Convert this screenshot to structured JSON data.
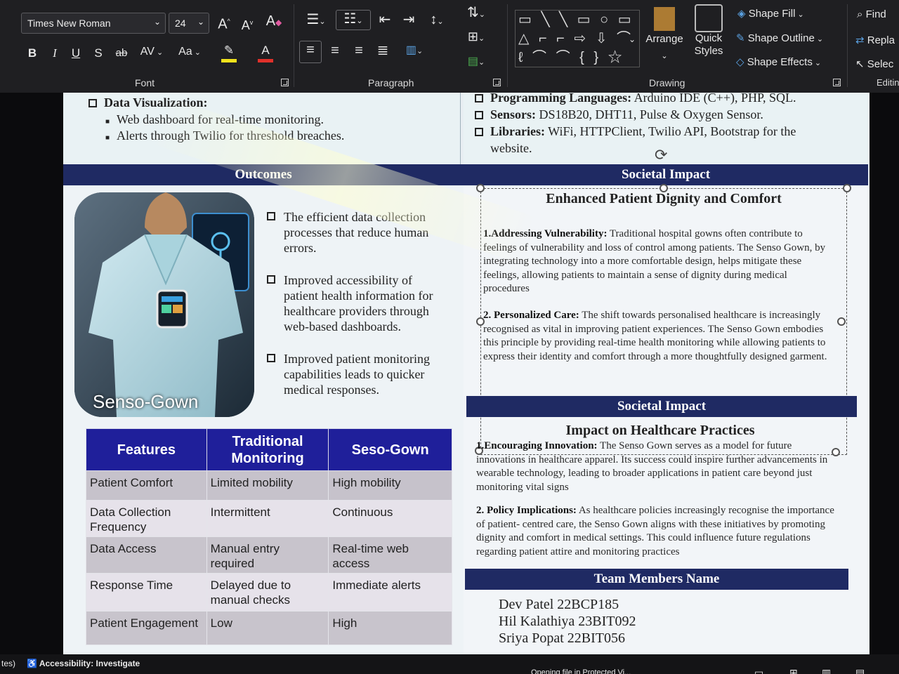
{
  "ribbon": {
    "font_group": {
      "font_name": "Times New Roman",
      "font_size": "24",
      "label": "Font",
      "buttons": {
        "grow": "A",
        "shrink": "A",
        "clear": "A",
        "bold": "B",
        "italic": "I",
        "underline": "U",
        "shadow": "S",
        "strike": "ab",
        "spacing": "AV",
        "case": "Aa",
        "highlight": "✎",
        "color": "A"
      }
    },
    "paragraph_group": {
      "label": "Paragraph"
    },
    "drawing_group": {
      "label": "Drawing",
      "arrange": "Arrange",
      "quick_styles": "Quick Styles",
      "shape_fill": "Shape Fill",
      "shape_outline": "Shape Outline",
      "shape_effects": "Shape Effects"
    },
    "editing_group": {
      "label": "Editin",
      "find": "Find",
      "replace": "Repla",
      "select": "Selec"
    }
  },
  "slide": {
    "data_visualization": {
      "heading": "Data Visualization:",
      "items": [
        "Web dashboard for real-time monitoring.",
        "Alerts through Twilio for threshold breaches."
      ]
    },
    "tech": {
      "programming": {
        "label": "Programming Languages:",
        "text": " Arduino IDE (C++), PHP, SQL."
      },
      "sensors": {
        "label": "Sensors:",
        "text": " DS18B20, DHT11, Pulse & Oxygen Sensor."
      },
      "libraries": {
        "label": "Libraries:",
        "text": " WiFi, HTTPClient, Twilio API, Bootstrap for the",
        "text2": "website."
      }
    },
    "outcomes": {
      "header": "Outcomes",
      "image_caption": "Senso-Gown",
      "items": [
        "The efficient data collection processes that reduce human errors.",
        "Improved accessibility of patient health information for healthcare providers through web-based dashboards.",
        "Improved patient monitoring capabilities leads to quicker medical responses."
      ]
    },
    "comparison_table": {
      "headers": [
        "Features",
        "Traditional Monitoring",
        "Seso-Gown"
      ],
      "rows": [
        [
          "Patient Comfort",
          "Limited mobility",
          "High mobility"
        ],
        [
          "Data Collection Frequency",
          "Intermittent",
          "Continuous"
        ],
        [
          "Data Access",
          "Manual entry required",
          "Real-time web access"
        ],
        [
          "Response Time",
          "Delayed due to manual checks",
          "Immediate alerts"
        ],
        [
          "Patient Engagement",
          "Low",
          "High"
        ]
      ]
    },
    "societal_impact_1": {
      "header": "Societal Impact",
      "title": "Enhanced Patient Dignity and Comfort",
      "p1_label": "1.Addressing Vulnerability:",
      "p1_text": " Traditional hospital gowns often contribute to feelings of vulnerability and loss of control among patients. The Senso Gown, by integrating technology into a more comfortable design, helps mitigate these feelings, allowing patients to maintain a sense of dignity during medical procedures",
      "p2_label": "2. Personalized Care:",
      "p2_text": " The shift towards personalised healthcare is increasingly recognised as vital in improving patient experiences. The Senso Gown embodies this principle by providing real-time health monitoring while allowing patients to express their identity and comfort through a more thoughtfully designed garment."
    },
    "societal_impact_2": {
      "header": "Societal Impact",
      "title": "Impact on Healthcare Practices",
      "p1_label": "1.Encouraging Innovation:",
      "p1_text": " The Senso Gown serves as a model for future innovations in healthcare apparel. Its success could inspire further advancements in wearable technology, leading to broader applications in patient care beyond just monitoring vital signs",
      "p2_label": "2. Policy Implications:",
      "p2_text": " As healthcare policies increasingly recognise the importance of patient- centred care, the Senso Gown aligns with these initiatives by promoting dignity and comfort in medical settings. This could influence future regulations regarding patient attire and monitoring practices"
    },
    "team": {
      "header": "Team Members Name",
      "members": [
        "Dev Patel 22BCP185",
        "Hil Kalathiya 23BIT092",
        "Sriya Popat 22BIT056"
      ]
    }
  },
  "statusbar": {
    "left": "tes)",
    "accessibility": "Accessibility: Investigate",
    "notice": "Opening file in Protected Vi..."
  },
  "colors": {
    "header_bar": "#1f2a63",
    "table_header": "#1f1f9a",
    "ribbon_bg": "#1f1f22"
  }
}
